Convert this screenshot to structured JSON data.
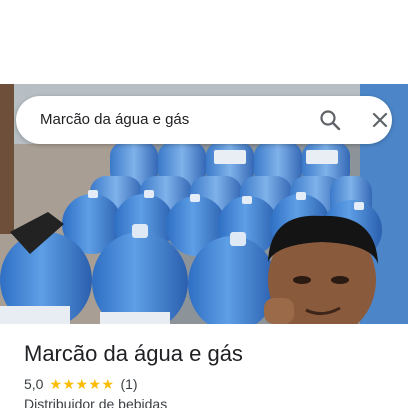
{
  "search": {
    "query": "Marcão da água e gás",
    "search_icon": "search-icon",
    "close_icon": "close-icon"
  },
  "place": {
    "photo": "place-photo",
    "title": "Marcão da água e gás",
    "rating_value": "5,0",
    "stars": 5,
    "star_color": "#fbbc04",
    "review_count": "(1)",
    "category": "Distribuidor de bebidas"
  }
}
